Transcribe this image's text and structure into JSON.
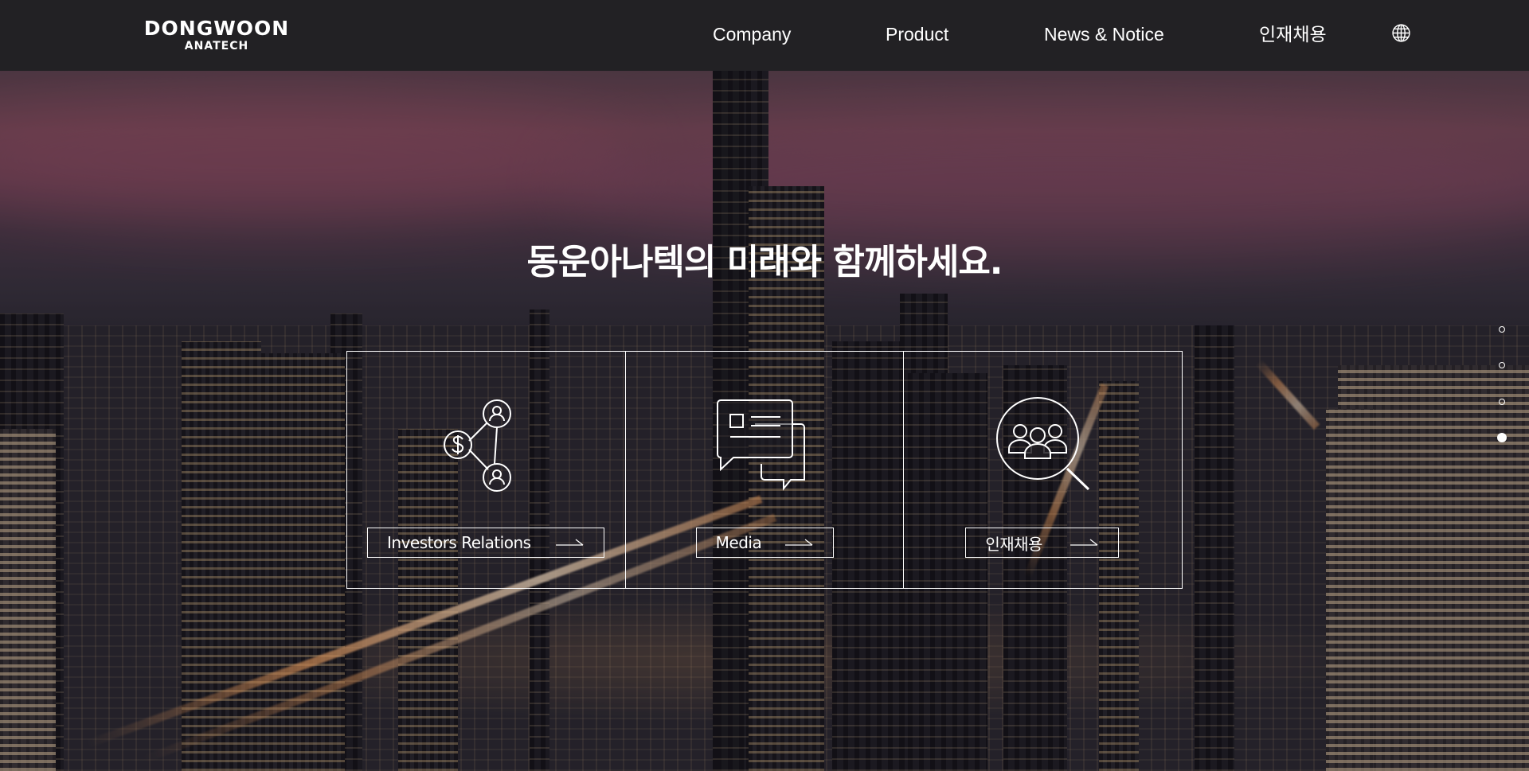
{
  "header": {
    "logo": {
      "main": "DONGWOON",
      "sub": "ANATECH"
    },
    "nav": [
      {
        "label": "Company"
      },
      {
        "label": "Product"
      },
      {
        "label": "News & Notice"
      },
      {
        "label": "인재채용"
      }
    ],
    "language_icon": "globe-icon"
  },
  "hero": {
    "headline": "동운아나텍의 미래와 함께하세요."
  },
  "cards": [
    {
      "icon": "investors-network-icon",
      "label": "Investors Relations"
    },
    {
      "icon": "media-chat-icon",
      "label": "Media"
    },
    {
      "icon": "recruit-search-icon",
      "label": "인재채용"
    }
  ],
  "pager": {
    "total": 4,
    "active_index": 3
  },
  "colors": {
    "header_bg": "#222124",
    "text": "#ffffff"
  }
}
